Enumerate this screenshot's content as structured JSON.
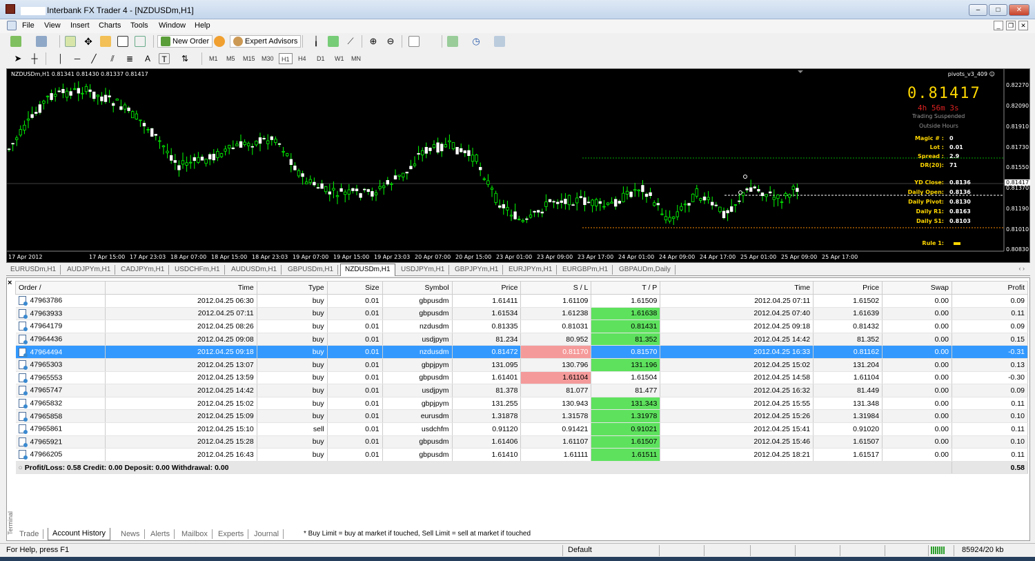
{
  "window": {
    "title": "Interbank FX Trader 4 - [NZDUSDm,H1]"
  },
  "menu": [
    "File",
    "View",
    "Insert",
    "Charts",
    "Tools",
    "Window",
    "Help"
  ],
  "toolbar": {
    "new_order": "New Order",
    "expert_advisors": "Expert Advisors",
    "timeframes": [
      "M1",
      "M5",
      "M15",
      "M30",
      "H1",
      "H4",
      "D1",
      "W1",
      "MN"
    ],
    "active_timeframe": "H1"
  },
  "chart": {
    "ohlc": "NZDUSDm,H1  0.81341 0.81430 0.81337 0.81417",
    "indicator": "pivots_v3_409",
    "big_price": "0.81417",
    "timer": "4h 56m 3s",
    "trading_status": "Trading Suspended",
    "hours_status": "Outside Hours",
    "info": [
      {
        "key": "Magic # :",
        "value": "0"
      },
      {
        "key": "Lot :",
        "value": "0.01"
      },
      {
        "key": "Spread :",
        "value": "2.9"
      },
      {
        "key": "DR(20):",
        "value": "71"
      }
    ],
    "pivots": [
      {
        "key": "YD Close:",
        "value": "0.8136"
      },
      {
        "key": "Daily Open:",
        "value": "0.8136"
      },
      {
        "key": "Daily Pivot:",
        "value": "0.8130"
      },
      {
        "key": "Daily R1:",
        "value": "0.8163"
      },
      {
        "key": "Daily S1:",
        "value": "0.8103"
      }
    ],
    "rule_label": "Rule 1:",
    "y_ticks": [
      "0.82270",
      "0.82090",
      "0.81910",
      "0.81730",
      "0.81550",
      "0.81370",
      "0.81190",
      "0.81010",
      "0.80830"
    ],
    "current_price_label": "0.81417",
    "x_ticks": [
      "17 Apr 2012",
      "17 Apr 15:00",
      "17 Apr 23:03",
      "18 Apr 07:00",
      "18 Apr 15:00",
      "18 Apr 23:03",
      "19 Apr 07:00",
      "19 Apr 15:00",
      "19 Apr 23:03",
      "20 Apr 07:00",
      "20 Apr 15:00",
      "23 Apr 01:00",
      "23 Apr 09:00",
      "23 Apr 17:00",
      "24 Apr 01:00",
      "24 Apr 09:00",
      "24 Apr 17:00",
      "25 Apr 01:00",
      "25 Apr 09:00",
      "25 Apr 17:00"
    ],
    "colors": {
      "background": "#000000",
      "candle": "#00ff00",
      "pivot_line": "#ffffff",
      "r1_line": "#00aa00",
      "s1_line": "#ff8c00",
      "gold": "#ffd700"
    }
  },
  "chart_tabs": [
    "EURUSDm,H1",
    "AUDJPYm,H1",
    "CADJPYm,H1",
    "USDCHFm,H1",
    "AUDUSDm,H1",
    "GBPUSDm,H1",
    "NZDUSDm,H1",
    "USDJPYm,H1",
    "GBPJPYm,H1",
    "EURJPYm,H1",
    "EURGBPm,H1",
    "GBPAUDm,Daily"
  ],
  "active_chart_tab": "NZDUSDm,H1",
  "history": {
    "columns": [
      "Order  /",
      "Time",
      "Type",
      "Size",
      "Symbol",
      "Price",
      "S / L",
      "T / P",
      "Time",
      "Price",
      "Swap",
      "Profit"
    ],
    "rows": [
      [
        "47963786",
        "2012.04.25 06:30",
        "buy",
        "0.01",
        "gbpusdm",
        "1.61411",
        "1.61109",
        "1.61509",
        "2012.04.25 07:11",
        "1.61502",
        "0.00",
        "0.09"
      ],
      [
        "47963933",
        "2012.04.25 07:11",
        "buy",
        "0.01",
        "gbpusdm",
        "1.61534",
        "1.61238",
        "1.61638",
        "2012.04.25 07:40",
        "1.61639",
        "0.00",
        "0.11"
      ],
      [
        "47964179",
        "2012.04.25 08:26",
        "buy",
        "0.01",
        "nzdusdm",
        "0.81335",
        "0.81031",
        "0.81431",
        "2012.04.25 09:18",
        "0.81432",
        "0.00",
        "0.09"
      ],
      [
        "47964436",
        "2012.04.25 09:08",
        "buy",
        "0.01",
        "usdjpym",
        "81.234",
        "80.952",
        "81.352",
        "2012.04.25 14:42",
        "81.352",
        "0.00",
        "0.15"
      ],
      [
        "47964494",
        "2012.04.25 09:18",
        "buy",
        "0.01",
        "nzdusdm",
        "0.81472",
        "0.81170",
        "0.81570",
        "2012.04.25 16:33",
        "0.81162",
        "0.00",
        "-0.31"
      ],
      [
        "47965303",
        "2012.04.25 13:07",
        "buy",
        "0.01",
        "gbpjpym",
        "131.095",
        "130.796",
        "131.196",
        "2012.04.25 15:02",
        "131.204",
        "0.00",
        "0.13"
      ],
      [
        "47965553",
        "2012.04.25 13:59",
        "buy",
        "0.01",
        "gbpusdm",
        "1.61401",
        "1.61104",
        "1.61504",
        "2012.04.25 14:58",
        "1.61104",
        "0.00",
        "-0.30"
      ],
      [
        "47965747",
        "2012.04.25 14:42",
        "buy",
        "0.01",
        "usdjpym",
        "81.378",
        "81.077",
        "81.477",
        "2012.04.25 16:32",
        "81.449",
        "0.00",
        "0.09"
      ],
      [
        "47965832",
        "2012.04.25 15:02",
        "buy",
        "0.01",
        "gbpjpym",
        "131.255",
        "130.943",
        "131.343",
        "2012.04.25 15:55",
        "131.348",
        "0.00",
        "0.11"
      ],
      [
        "47965858",
        "2012.04.25 15:09",
        "buy",
        "0.01",
        "eurusdm",
        "1.31878",
        "1.31578",
        "1.31978",
        "2012.04.25 15:26",
        "1.31984",
        "0.00",
        "0.10"
      ],
      [
        "47965861",
        "2012.04.25 15:10",
        "sell",
        "0.01",
        "usdchfm",
        "0.91120",
        "0.91421",
        "0.91021",
        "2012.04.25 15:41",
        "0.91020",
        "0.00",
        "0.11"
      ],
      [
        "47965921",
        "2012.04.25 15:28",
        "buy",
        "0.01",
        "gbpusdm",
        "1.61406",
        "1.61107",
        "1.61507",
        "2012.04.25 15:46",
        "1.61507",
        "0.00",
        "0.10"
      ],
      [
        "47966205",
        "2012.04.25 16:43",
        "buy",
        "0.01",
        "gbpusdm",
        "1.61410",
        "1.61111",
        "1.61511",
        "2012.04.25 18:21",
        "1.61517",
        "0.00",
        "0.11"
      ]
    ],
    "highlights": {
      "tp_hit_rows": [
        1,
        2,
        3,
        4,
        5,
        8,
        9,
        10,
        11,
        12
      ],
      "sl_hit_rows": [
        4,
        6
      ],
      "selected_row": 4
    },
    "summary": "Profit/Loss: 0.58  Credit: 0.00  Deposit: 0.00  Withdrawal: 0.00",
    "summary_total": "0.58"
  },
  "terminal_label": "Terminal",
  "terminal_tabs": [
    "Trade",
    "Account History",
    "News",
    "Alerts",
    "Mailbox",
    "Experts",
    "Journal"
  ],
  "active_terminal_tab": "Account History",
  "terminal_hint": "* Buy Limit = buy at market if touched, Sell Limit = sell at market if touched",
  "status": {
    "help": "For Help, press F1",
    "profile": "Default",
    "traffic": "85924/20 kb"
  }
}
